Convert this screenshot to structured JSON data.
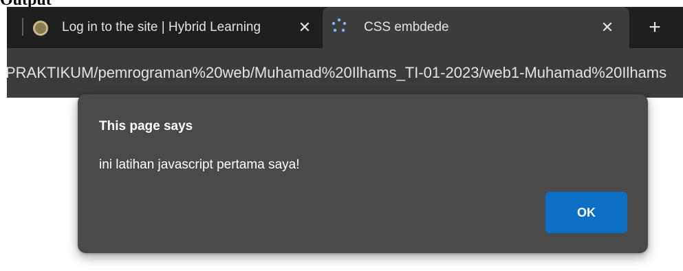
{
  "document": {
    "heading_fragment": "Output"
  },
  "browser": {
    "tabs": [
      {
        "title": "Log in to the site | Hybrid Learning",
        "active": false,
        "favicon": "moodle-favicon-icon"
      },
      {
        "title": "CSS embdede",
        "active": true,
        "favicon": "loading-spinner-icon"
      }
    ],
    "close_glyph": "✕",
    "new_tab_glyph": "+",
    "address_url": "PRAKTIKUM/pemrograman%20web/Muhamad%20Ilhams_TI-01-2023/web1-Muhamad%20Ilhams"
  },
  "dialog": {
    "title": "This page says",
    "message": "ini latihan javascript pertama saya!",
    "ok_label": "OK"
  },
  "colors": {
    "tabbar_bg": "#1f1f1f",
    "active_tab_bg": "#3c3c3c",
    "dialog_bg": "#4a4a4a",
    "ok_button_bg": "#0b6fc6"
  }
}
